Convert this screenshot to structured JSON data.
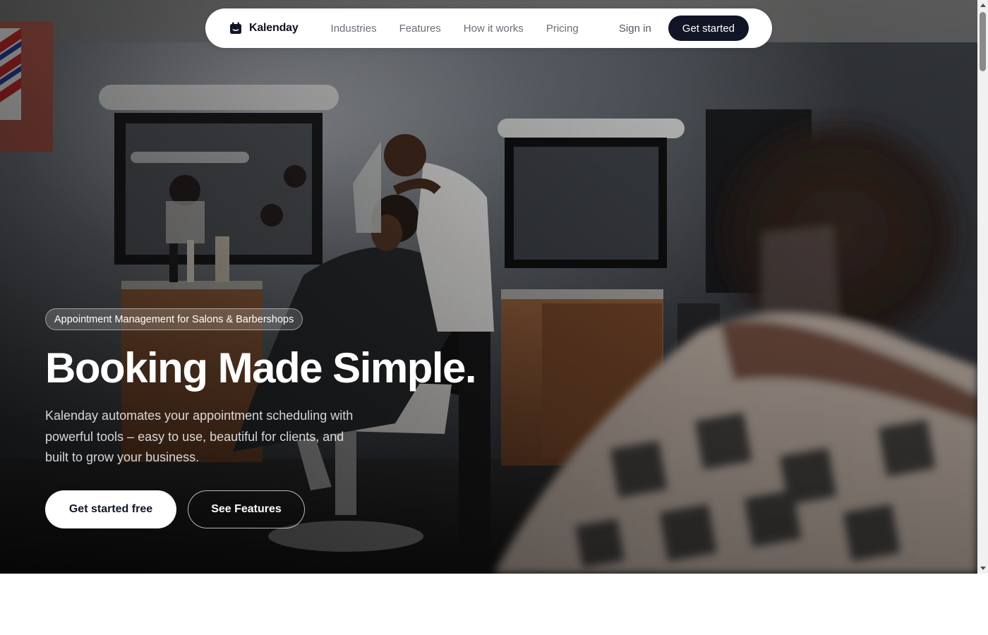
{
  "navbar": {
    "brand_name": "Kalenday",
    "brand_icon": "calendar-icon",
    "links": [
      "Industries",
      "Features",
      "How it works",
      "Pricing"
    ],
    "signin_label": "Sign in",
    "cta_label": "Get started"
  },
  "hero": {
    "badge": "Appointment Management for Salons & Barbershops",
    "headline": "Booking Made Simple.",
    "subtext": "Kalenday automates your appointment scheduling with powerful tools – easy to use, beautiful for clients, and built to grow your business.",
    "primary_button": "Get started free",
    "secondary_button": "See Features",
    "background_image": "barbershop-photo"
  },
  "colors": {
    "brand_dark": "#111526",
    "white": "#ffffff",
    "nav_text": "#6b6e76"
  }
}
